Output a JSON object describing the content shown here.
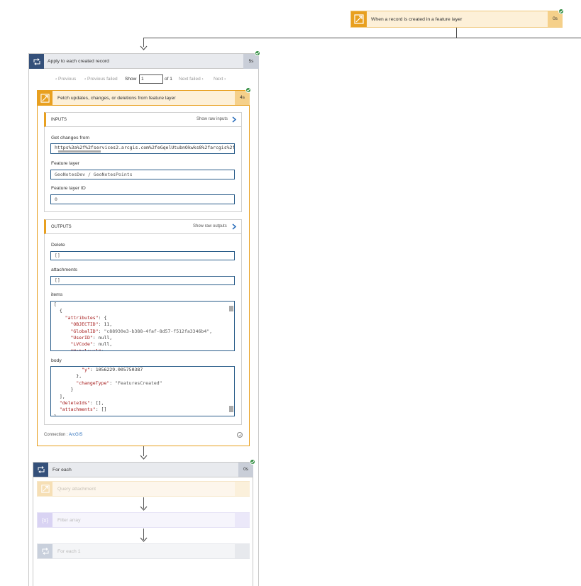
{
  "trigger": {
    "title": "When a record is created in a feature layer",
    "duration": "0s"
  },
  "apply": {
    "title": "Apply to each created record",
    "duration": "5s"
  },
  "pager": {
    "previous": "Previous",
    "previous_failed": "Previous failed",
    "show": "Show",
    "value": "1",
    "of": "of 1",
    "next_failed": "Next failed",
    "next": "Next"
  },
  "fetch": {
    "title": "Fetch updates, changes, or deletions from feature layer",
    "duration": "4s",
    "inputs": {
      "header": "INPUTS",
      "show_raw": "Show raw inputs",
      "get_changes_label": "Get changes from",
      "get_changes_value": "https%3a%2f%2fservices2.arcgis.com%2feGqelUtubnOkwks8%2farcgis%2f",
      "feature_layer_label": "Feature layer",
      "feature_layer_value": "GeoNotesDev / GeoNotesPoints",
      "feature_layer_id_label": "Feature layer ID",
      "feature_layer_id_value": "0"
    },
    "outputs": {
      "header": "OUTPUTS",
      "show_raw": "Show raw outputs",
      "delete_label": "Delete",
      "delete_value": "[]",
      "attachments_label": "attachments",
      "attachments_value": "[]",
      "items_label": "items",
      "body_label": "body"
    },
    "connection_label": "Connection :",
    "connection_value": "ArcGIS"
  },
  "foreach": {
    "title": "For each",
    "duration": "0s"
  },
  "children": [
    {
      "title": "Query attachment"
    },
    {
      "title": "Filter array"
    },
    {
      "title": "For each 1"
    }
  ],
  "colors": {
    "accent_orange": "#e8a020",
    "accent_blue": "#34507a",
    "success": "#2e8b3e",
    "link": "#2a6ebb"
  }
}
